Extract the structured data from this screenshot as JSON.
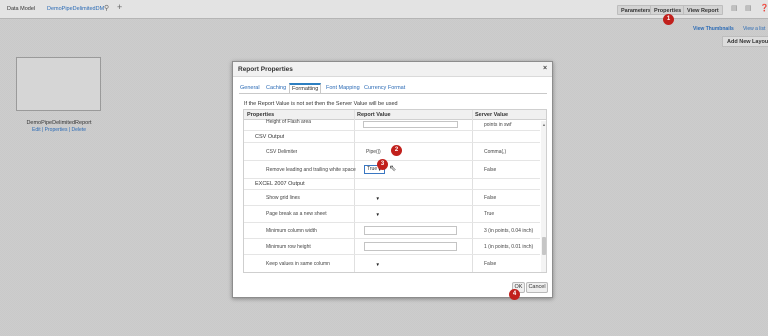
{
  "topbar": {
    "data_model_label": "Data Model",
    "data_model_name": "DemoPipeDelimitedDM",
    "buttons": [
      "Parameters",
      "Properties",
      "View Report"
    ],
    "view_thumbnails": "View Thumbnails",
    "view_list": "View a list",
    "add_new_layout": "Add New Layout"
  },
  "thumbnail": {
    "title": "DemoPipeDelimitedReport",
    "links": "Edit | Properties | Delete"
  },
  "dialog": {
    "title": "Report Properties",
    "close": "×",
    "tabs": [
      "General",
      "Caching",
      "Formatting",
      "Font Mapping",
      "Currency Format"
    ],
    "active_tab": "Formatting",
    "note": "If the Report Value is not set then the Server Value will be used",
    "columns": [
      "Properties",
      "Report Value",
      "Server Value"
    ],
    "rows": [
      {
        "property": "Height of Flash area",
        "server": "points in swf"
      },
      {
        "property": "CSV Output",
        "section": true
      },
      {
        "property": "CSV Delimiter",
        "report": "Pipe(|)",
        "server": "Comma(,)"
      },
      {
        "property": "Remove leading and trailing white space",
        "report": "True",
        "server": "False"
      },
      {
        "property": "EXCEL 2007 Output",
        "section": true
      },
      {
        "property": "Show grid lines",
        "report": "",
        "server": "False"
      },
      {
        "property": "Page break as a new sheet",
        "report": "",
        "server": "True"
      },
      {
        "property": "Minimum column width",
        "server": "3 (in points, 0.04 inch)"
      },
      {
        "property": "Minimum row height",
        "server": "1 (in points, 0.01 inch)"
      },
      {
        "property": "Keep values in same column",
        "report": "",
        "server": "False"
      }
    ],
    "ok": "OK",
    "cancel": "Cancel"
  },
  "annotations": [
    "1",
    "2",
    "3",
    "4"
  ],
  "colors": {
    "accent": "#2a6ab5",
    "badge": "#c1201c",
    "active_tab": "#2d7fc1"
  }
}
